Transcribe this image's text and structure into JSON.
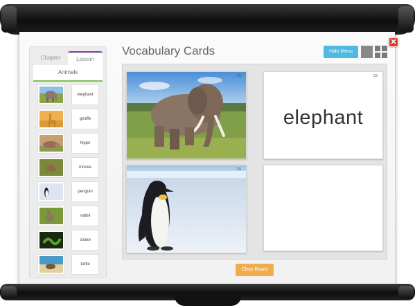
{
  "sidebar": {
    "tabs": {
      "chapter": "Chapter",
      "lesson": "Lesson"
    },
    "category": "Animals",
    "items": [
      {
        "label": "elephant",
        "icon": "elephant-thumbnail"
      },
      {
        "label": "giraffe",
        "icon": "giraffe-thumbnail"
      },
      {
        "label": "hippo",
        "icon": "hippo-thumbnail"
      },
      {
        "label": "mouse",
        "icon": "mouse-thumbnail"
      },
      {
        "label": "penguin",
        "icon": "penguin-thumbnail"
      },
      {
        "label": "rabbit",
        "icon": "rabbit-thumbnail"
      },
      {
        "label": "snake",
        "icon": "snake-thumbnail"
      },
      {
        "label": "turtle",
        "icon": "turtle-thumbnail"
      }
    ]
  },
  "header": {
    "title": "Vocabulary Cards",
    "hide_menu_label": "Hide Menu"
  },
  "board": {
    "cards": [
      {
        "type": "image",
        "subject": "elephant",
        "chapter": "C5"
      },
      {
        "type": "word",
        "word": "elephant",
        "chapter": "C5"
      },
      {
        "type": "image",
        "subject": "penguin",
        "chapter": "C5"
      },
      {
        "type": "blank"
      }
    ]
  },
  "footer": {
    "clear_label": "Clear Board"
  },
  "colors": {
    "accent_blue": "#4fb9e2",
    "accent_orange": "#f0ad4e",
    "lesson_tab": "#7b3aa0",
    "category_underline": "#7fbf4a",
    "close_red": "#d93a2b"
  }
}
